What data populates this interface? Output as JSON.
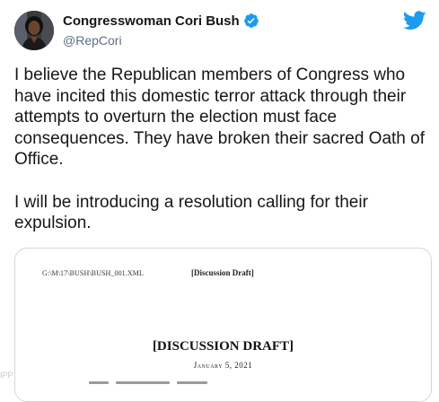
{
  "tweet": {
    "display_name": "Congresswoman Cori Bush",
    "handle": "@RepCori",
    "verified": true,
    "text": "I believe the Republican members of Congress who\nhave incited this domestic terror attack through their\nattempts to overturn the election must face\nconsequences. They have broken their sacred Oath of\nOffice.\n\nI will be introducing a resolution calling for their\nexpulsion."
  },
  "icons": {
    "brand": "twitter-bird-icon",
    "verified": "verified-badge-icon",
    "brand_color": "#1d9bf0",
    "verified_color": "#1d9bf0"
  },
  "media": {
    "doc_path": "G:\\M\\17\\BUSH\\BUSH_001.XML",
    "draft_label_small": "[Discussion Draft]",
    "title": "[DISCUSSION DRAFT]",
    "date": "January 5, 2021"
  },
  "watermark": "IPP"
}
